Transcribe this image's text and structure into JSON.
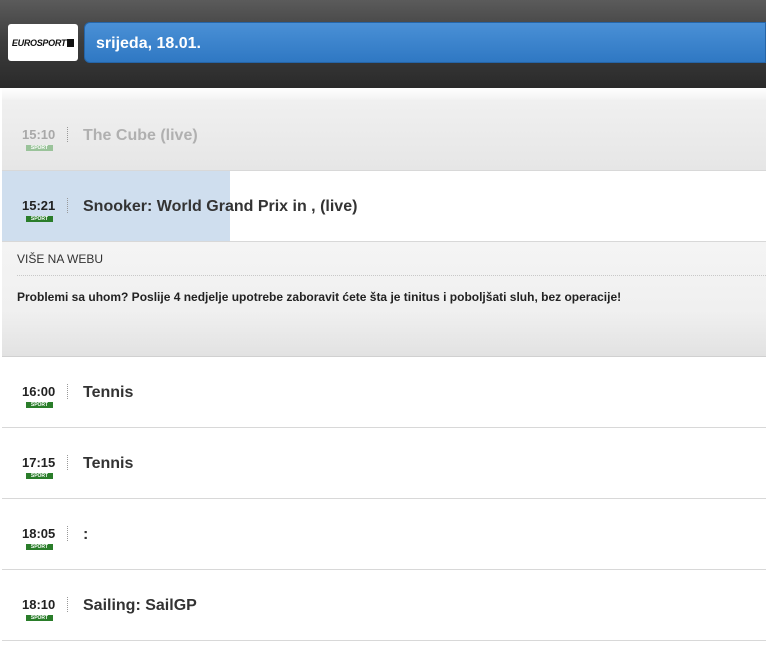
{
  "header": {
    "logo_text": "EUROSPORT",
    "logo_badge": "1",
    "date": "srijeda, 18.01."
  },
  "programmes": [
    {
      "time": "15:10",
      "badge": "SPORT",
      "title": "The Cube (live)",
      "state": "past"
    },
    {
      "time": "15:21",
      "badge": "SPORT",
      "title": "Snooker: World Grand Prix in , (live)",
      "state": "current"
    },
    {
      "time": "16:00",
      "badge": "SPORT",
      "title": "Tennis",
      "state": "upcoming"
    },
    {
      "time": "17:15",
      "badge": "SPORT",
      "title": "Tennis",
      "state": "upcoming"
    },
    {
      "time": "18:05",
      "badge": "SPORT",
      "title": ":",
      "state": "upcoming"
    },
    {
      "time": "18:10",
      "badge": "SPORT",
      "title": "Sailing: SailGP",
      "state": "upcoming"
    }
  ],
  "detail": {
    "more_link": "VIŠE NA WEBU",
    "promo": "Problemi sa uhom? Poslije 4 nedjelje upotrebe zaboravit ćete šta je tinitus i poboljšati sluh, bez operacije!"
  },
  "colors": {
    "accent_blue": "#3a84cc",
    "sport_badge": "#2a7d2a",
    "current_highlight": "#cfdeee"
  }
}
